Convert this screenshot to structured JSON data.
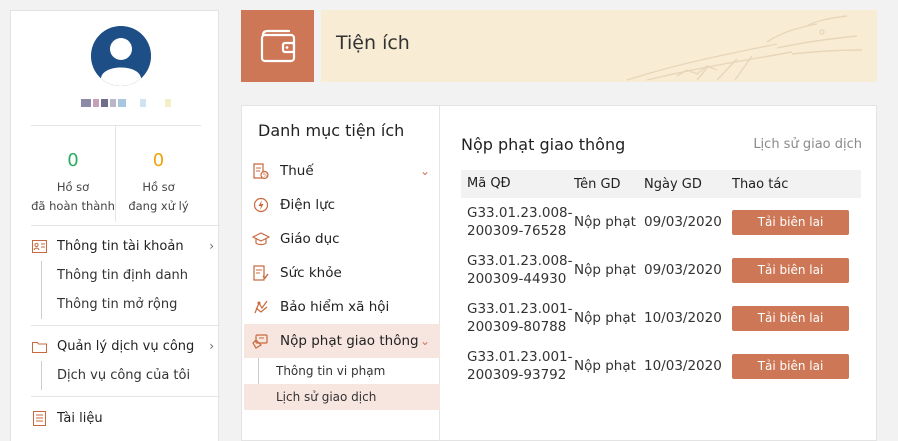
{
  "profile": {
    "stats": [
      {
        "num": "0",
        "label_line1": "Hồ sơ",
        "label_line2": "đã hoàn thành"
      },
      {
        "num": "0",
        "label_line1": "Hồ sơ",
        "label_line2": "đang xử lý"
      }
    ],
    "account_menu": {
      "label": "Thông tin tài khoản",
      "items": [
        "Thông tin định danh",
        "Thông tin mở rộng"
      ]
    },
    "public_service_menu": {
      "label": "Quản lý dịch vụ công",
      "items": [
        "Dịch vụ công của tôi"
      ]
    },
    "documents_label": "Tài liệu"
  },
  "banner": {
    "title": "Tiện ích"
  },
  "categories": {
    "title": "Danh mục tiện ích",
    "items": [
      {
        "label": "Thuế",
        "icon": "tax-icon"
      },
      {
        "label": "Điện lực",
        "icon": "electricity-icon"
      },
      {
        "label": "Giáo dục",
        "icon": "education-icon"
      },
      {
        "label": "Sức khỏe",
        "icon": "health-icon"
      },
      {
        "label": "Bảo hiểm xã hội",
        "icon": "social-insurance-icon"
      },
      {
        "label": "Nộp phạt giao thông",
        "icon": "traffic-fine-icon"
      }
    ],
    "sub_items": [
      "Thông tin vi phạm",
      "Lịch sử giao dịch"
    ]
  },
  "content": {
    "title": "Nộp phạt giao thông",
    "history_link": "Lịch sử giao dịch",
    "columns": [
      "Mã QĐ",
      "Tên GD",
      "Ngày GD",
      "Thao tác"
    ],
    "rows": [
      {
        "code1": "G33.01.23.008-",
        "code2": "200309-76528",
        "name": "Nộp phạt",
        "date": "09/03/2020",
        "action": "Tải biên lai"
      },
      {
        "code1": "G33.01.23.008-",
        "code2": "200309-44930",
        "name": "Nộp phạt",
        "date": "09/03/2020",
        "action": "Tải biên lai"
      },
      {
        "code1": "G33.01.23.001-",
        "code2": "200309-80788",
        "name": "Nộp phạt",
        "date": "10/03/2020",
        "action": "Tải biên lai"
      },
      {
        "code1": "G33.01.23.001-",
        "code2": "200309-93792",
        "name": "Nộp phạt",
        "date": "10/03/2020",
        "action": "Tải biên lai"
      }
    ]
  },
  "colors": {
    "accent": "#cd7756",
    "banner_bg": "#f9ecd5",
    "avatar_bg": "#1d4f86",
    "stat_done": "#27ae60",
    "stat_processing": "#f0a30a"
  }
}
